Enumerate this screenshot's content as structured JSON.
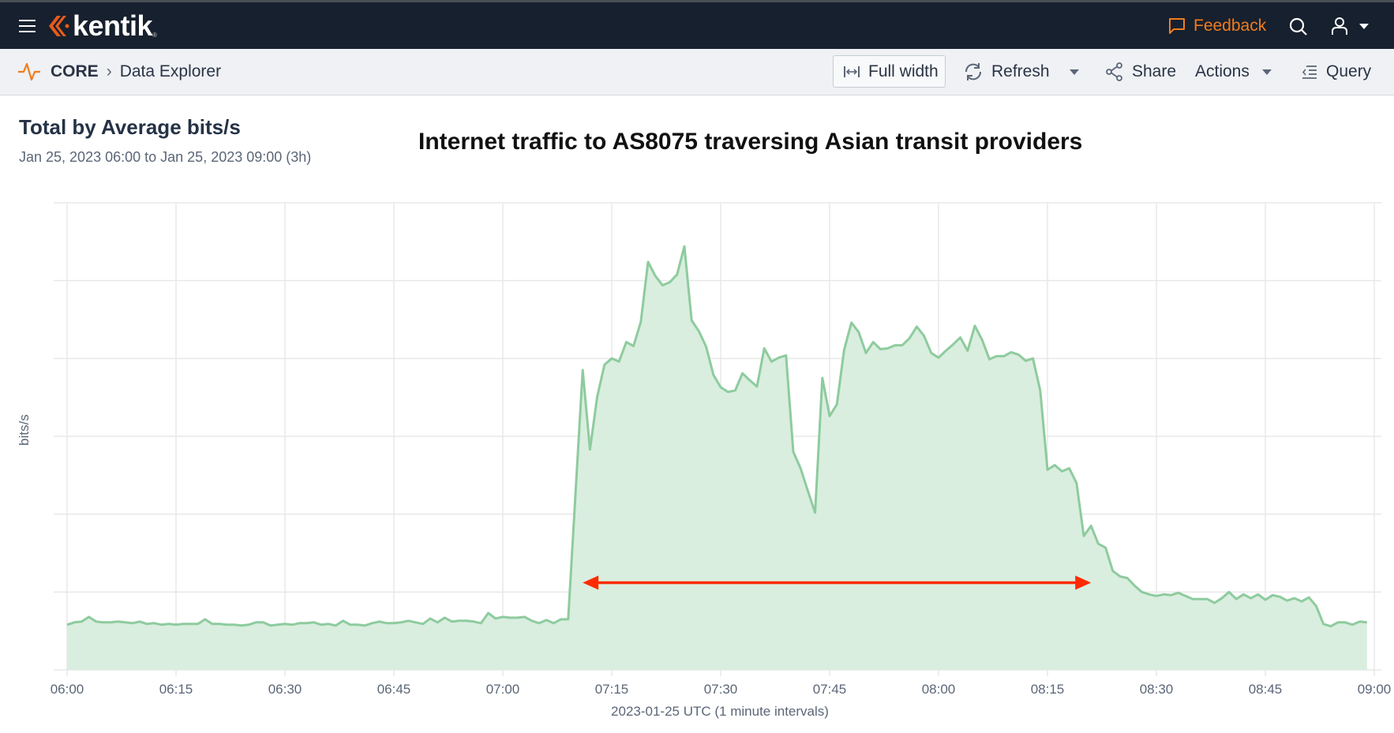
{
  "topbar": {
    "menu_icon": "hamburger-icon",
    "logo_text": "kentik",
    "feedback_label": "Feedback",
    "search_icon": "search-icon",
    "user_icon": "user-icon",
    "accent_color": "#f07c1e"
  },
  "breadcrumb": {
    "section": "CORE",
    "page": "Data Explorer"
  },
  "toolbar": {
    "full_width": "Full width",
    "refresh": "Refresh",
    "share": "Share",
    "actions": "Actions",
    "query": "Query"
  },
  "panel": {
    "title": "Total by Average bits/s",
    "subtitle": "Jan 25, 2023 06:00 to Jan 25, 2023 09:00 (3h)"
  },
  "chart_data": {
    "type": "area",
    "title": "Internet traffic to AS8075 traversing Asian transit providers",
    "xlabel": "2023-01-25 UTC (1 minute intervals)",
    "ylabel": "bits/s",
    "x_ticks": [
      "06:00",
      "06:15",
      "06:30",
      "06:45",
      "07:00",
      "07:15",
      "07:30",
      "07:45",
      "08:00",
      "08:15",
      "08:30",
      "08:45",
      "09:00"
    ],
    "xlim": [
      "06:00",
      "09:00"
    ],
    "ylim": [
      0,
      6
    ],
    "y_tick_labels_shown": false,
    "grid": true,
    "line_color": "#8ecb9e",
    "fill_color": "#d9eedf",
    "x": [
      "06:00",
      "06:01",
      "06:02",
      "06:03",
      "06:04",
      "06:05",
      "06:06",
      "06:07",
      "06:08",
      "06:09",
      "06:10",
      "06:11",
      "06:12",
      "06:13",
      "06:14",
      "06:15",
      "06:16",
      "06:17",
      "06:18",
      "06:19",
      "06:20",
      "06:21",
      "06:22",
      "06:23",
      "06:24",
      "06:25",
      "06:26",
      "06:27",
      "06:28",
      "06:29",
      "06:30",
      "06:31",
      "06:32",
      "06:33",
      "06:34",
      "06:35",
      "06:36",
      "06:37",
      "06:38",
      "06:39",
      "06:40",
      "06:41",
      "06:42",
      "06:43",
      "06:44",
      "06:45",
      "06:46",
      "06:47",
      "06:48",
      "06:49",
      "06:50",
      "06:51",
      "06:52",
      "06:53",
      "06:54",
      "06:55",
      "06:56",
      "06:57",
      "06:58",
      "06:59",
      "07:00",
      "07:01",
      "07:02",
      "07:03",
      "07:04",
      "07:05",
      "07:06",
      "07:07",
      "07:08",
      "07:09",
      "07:10",
      "07:11",
      "07:12",
      "07:13",
      "07:14",
      "07:15",
      "07:16",
      "07:17",
      "07:18",
      "07:19",
      "07:20",
      "07:21",
      "07:22",
      "07:23",
      "07:24",
      "07:25",
      "07:26",
      "07:27",
      "07:28",
      "07:29",
      "07:30",
      "07:31",
      "07:32",
      "07:33",
      "07:34",
      "07:35",
      "07:36",
      "07:37",
      "07:38",
      "07:39",
      "07:40",
      "07:41",
      "07:42",
      "07:43",
      "07:44",
      "07:45",
      "07:46",
      "07:47",
      "07:48",
      "07:49",
      "07:50",
      "07:51",
      "07:52",
      "07:53",
      "07:54",
      "07:55",
      "07:56",
      "07:57",
      "07:58",
      "07:59",
      "08:00",
      "08:01",
      "08:02",
      "08:03",
      "08:04",
      "08:05",
      "08:06",
      "08:07",
      "08:08",
      "08:09",
      "08:10",
      "08:11",
      "08:12",
      "08:13",
      "08:14",
      "08:15",
      "08:16",
      "08:17",
      "08:18",
      "08:19",
      "08:20",
      "08:21",
      "08:22",
      "08:23",
      "08:24",
      "08:25",
      "08:26",
      "08:27",
      "08:28",
      "08:29",
      "08:30",
      "08:31",
      "08:32",
      "08:33",
      "08:34",
      "08:35",
      "08:36",
      "08:37",
      "08:38",
      "08:39",
      "08:40",
      "08:41",
      "08:42",
      "08:43",
      "08:44",
      "08:45",
      "08:46",
      "08:47",
      "08:48",
      "08:49",
      "08:50",
      "08:51",
      "08:52",
      "08:53",
      "08:54",
      "08:55",
      "08:56",
      "08:57",
      "08:58",
      "08:59"
    ],
    "values": [
      0.58,
      0.61,
      0.62,
      0.68,
      0.62,
      0.61,
      0.61,
      0.62,
      0.61,
      0.6,
      0.62,
      0.59,
      0.6,
      0.58,
      0.59,
      0.58,
      0.59,
      0.59,
      0.59,
      0.65,
      0.59,
      0.59,
      0.58,
      0.58,
      0.57,
      0.58,
      0.61,
      0.61,
      0.57,
      0.58,
      0.59,
      0.58,
      0.6,
      0.6,
      0.61,
      0.58,
      0.59,
      0.57,
      0.63,
      0.58,
      0.58,
      0.57,
      0.6,
      0.62,
      0.6,
      0.6,
      0.61,
      0.63,
      0.61,
      0.59,
      0.66,
      0.61,
      0.67,
      0.62,
      0.63,
      0.63,
      0.62,
      0.6,
      0.73,
      0.66,
      0.68,
      0.67,
      0.67,
      0.68,
      0.63,
      0.6,
      0.64,
      0.6,
      0.65,
      0.65,
      2.25,
      3.85,
      2.83,
      3.51,
      3.92,
      4.0,
      3.96,
      4.21,
      4.16,
      4.47,
      5.24,
      5.06,
      4.94,
      4.98,
      5.08,
      5.44,
      4.49,
      4.35,
      4.15,
      3.79,
      3.63,
      3.57,
      3.59,
      3.81,
      3.72,
      3.64,
      4.13,
      3.96,
      4.01,
      4.04,
      2.8,
      2.59,
      2.3,
      2.02,
      3.75,
      3.26,
      3.41,
      4.11,
      4.46,
      4.34,
      4.07,
      4.21,
      4.12,
      4.13,
      4.17,
      4.17,
      4.26,
      4.41,
      4.29,
      4.07,
      4.01,
      4.1,
      4.18,
      4.27,
      4.1,
      4.42,
      4.24,
      3.99,
      4.03,
      4.03,
      4.08,
      4.05,
      3.97,
      4.0,
      3.59,
      2.57,
      2.63,
      2.55,
      2.59,
      2.4,
      1.72,
      1.85,
      1.62,
      1.57,
      1.27,
      1.2,
      1.18,
      1.08,
      1.0,
      0.97,
      0.95,
      0.97,
      0.96,
      0.99,
      0.95,
      0.91,
      0.91,
      0.91,
      0.86,
      0.92,
      1.0,
      0.91,
      0.97,
      0.92,
      0.97,
      0.9,
      0.96,
      0.94,
      0.89,
      0.92,
      0.88,
      0.93,
      0.82,
      0.59,
      0.56,
      0.61,
      0.61,
      0.58,
      0.62,
      0.61
    ],
    "annotations": [
      {
        "type": "double-arrow",
        "from_x": "07:11",
        "to_x": "08:21",
        "y": 1.12,
        "color": "#ff2a00"
      }
    ]
  }
}
